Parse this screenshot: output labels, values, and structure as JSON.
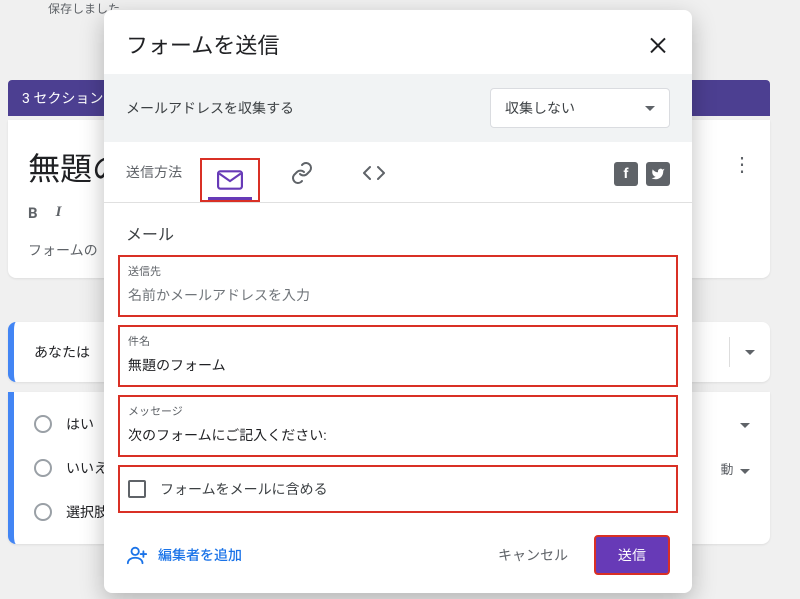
{
  "bg": {
    "saved_text": "保存しました",
    "sections_label": "3 セクション",
    "form_title": "無題の",
    "toolbar": {
      "bold": "B",
      "italic": "I"
    },
    "form_desc": "フォームの",
    "q1_label": "あなたは",
    "opts": {
      "yes": "はい",
      "no": "いいえ",
      "other": "選択肢",
      "tail": "動"
    }
  },
  "dialog": {
    "title": "フォームを送信",
    "collect_label": "メールアドレスを収集する",
    "collect_value": "収集しない",
    "send_via_label": "送信方法",
    "section_label": "メール",
    "fields": {
      "to": {
        "label": "送信先",
        "placeholder": "名前かメールアドレスを入力"
      },
      "subject": {
        "label": "件名",
        "value": "無題のフォーム"
      },
      "message": {
        "label": "メッセージ",
        "value": "次のフォームにご記入ください:"
      }
    },
    "include_form_label": "フォームをメールに含める",
    "add_collaborators": "編集者を追加",
    "cancel": "キャンセル",
    "send": "送信",
    "social": {
      "fb": "f",
      "tw": ""
    }
  }
}
